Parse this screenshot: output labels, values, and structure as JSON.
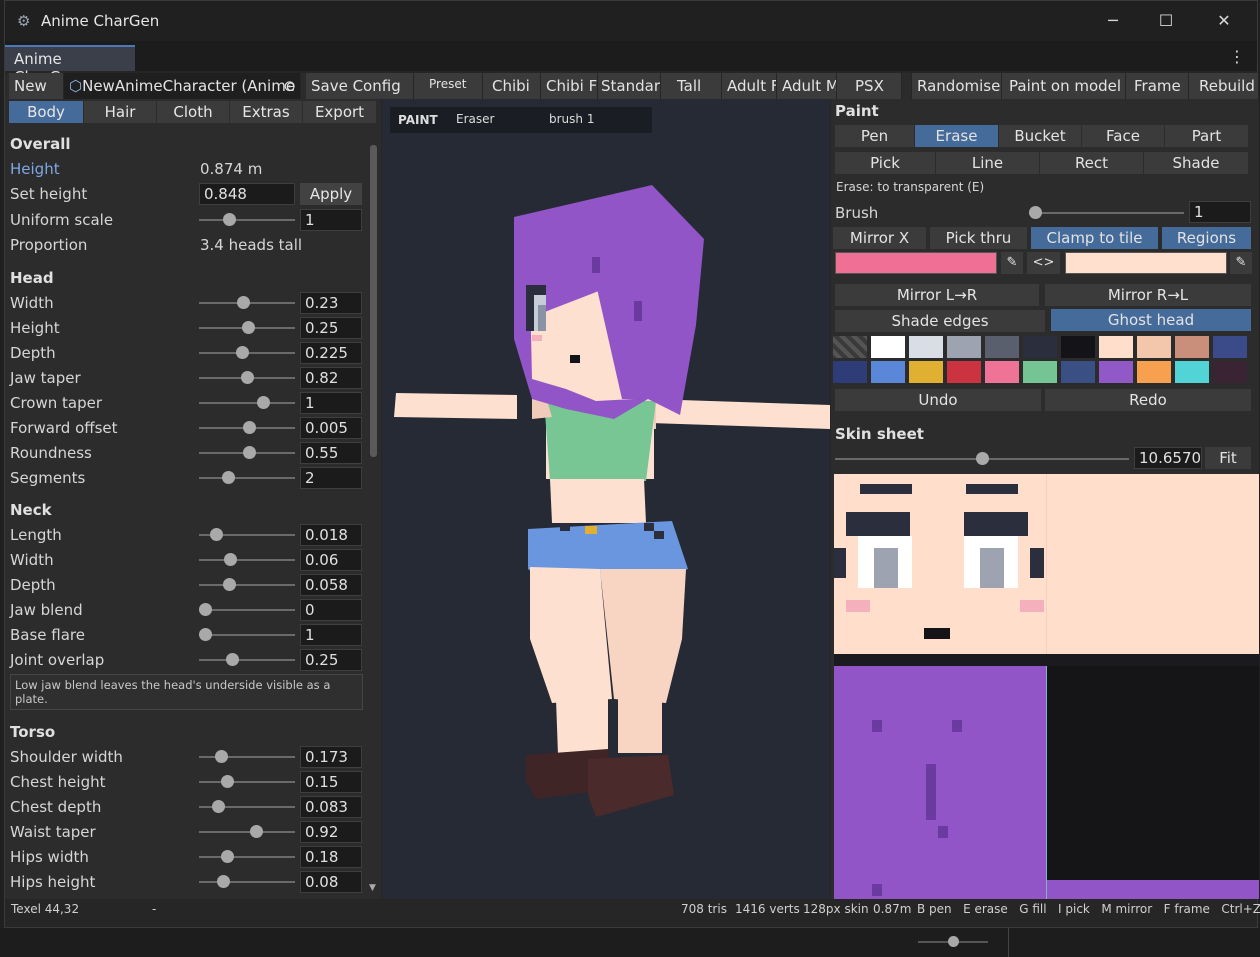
{
  "window": {
    "title": "Anime CharGen",
    "doc_tab": "Anime CharGen"
  },
  "toolbar": {
    "new": "New",
    "character_name": "NewAnimeCharacter (Anime",
    "save_config": "Save Config",
    "preset_label": "Preset",
    "presets": [
      "Chibi",
      "Chibi F",
      "Standard",
      "Tall",
      "Adult F",
      "Adult M",
      "PSX"
    ],
    "randomise": "Randomise",
    "paint_on_model": "Paint on model",
    "frame": "Frame",
    "rebuild": "Rebuild"
  },
  "left_tabs": [
    "Body",
    "Hair",
    "Cloth",
    "Extras",
    "Export"
  ],
  "overall": {
    "title": "Overall",
    "height_label": "Height",
    "height_value": "0.874 m",
    "set_height_label": "Set height",
    "set_height_value": "0.848",
    "apply": "Apply",
    "uniform_scale_label": "Uniform scale",
    "uniform_scale_value": "1",
    "proportion_label": "Proportion",
    "proportion_value": "3.4 heads tall"
  },
  "head": {
    "title": "Head",
    "rows": [
      {
        "label": "Width",
        "value": "0.23",
        "level": 0.46
      },
      {
        "label": "Height",
        "value": "0.25",
        "level": 0.52
      },
      {
        "label": "Depth",
        "value": "0.225",
        "level": 0.44
      },
      {
        "label": "Jaw taper",
        "value": "0.82",
        "level": 0.5
      },
      {
        "label": "Crown taper",
        "value": "1",
        "level": 0.7
      },
      {
        "label": "Forward offset",
        "value": "0.005",
        "level": 0.53
      },
      {
        "label": "Roundness",
        "value": "0.55",
        "level": 0.53
      },
      {
        "label": "Segments",
        "value": "2",
        "level": 0.28
      }
    ]
  },
  "neck": {
    "title": "Neck",
    "rows": [
      {
        "label": "Length",
        "value": "0.018",
        "level": 0.13
      },
      {
        "label": "Width",
        "value": "0.06",
        "level": 0.3
      },
      {
        "label": "Depth",
        "value": "0.058",
        "level": 0.29
      },
      {
        "label": "Jaw blend",
        "value": "0",
        "level": 0.0
      },
      {
        "label": "Base flare",
        "value": "1",
        "level": 0.0
      },
      {
        "label": "Joint overlap",
        "value": "0.25",
        "level": 0.33
      }
    ],
    "hint": "Low jaw blend leaves the head's underside visible as a plate."
  },
  "torso": {
    "title": "Torso",
    "rows": [
      {
        "label": "Shoulder width",
        "value": "0.173",
        "level": 0.19
      },
      {
        "label": "Chest height",
        "value": "0.15",
        "level": 0.26
      },
      {
        "label": "Chest depth",
        "value": "0.083",
        "level": 0.16
      },
      {
        "label": "Waist taper",
        "value": "0.92",
        "level": 0.62
      },
      {
        "label": "Hips width",
        "value": "0.18",
        "level": 0.26
      },
      {
        "label": "Hips height",
        "value": "0.08",
        "level": 0.22
      }
    ]
  },
  "viewport": {
    "mode": "PAINT",
    "tool": "Eraser",
    "brush": "brush 1"
  },
  "paint": {
    "title": "Paint",
    "tools_row1": [
      "Pen",
      "Erase",
      "Bucket",
      "Face",
      "Part"
    ],
    "tools_row2": [
      "Pick",
      "Line",
      "Rect",
      "Shade"
    ],
    "active_tool": "Erase",
    "hint": "Erase: to transparent (E)",
    "brush_label": "Brush",
    "brush_value": "1",
    "brush_level": 0.0,
    "options": [
      "Mirror X",
      "Pick thru",
      "Clamp to tile",
      "Regions"
    ],
    "primary_color": "#f06f95",
    "secondary_color": "#ffe0cf",
    "swap": "<>",
    "mirror_lr": "Mirror L→R",
    "mirror_rl": "Mirror R→L",
    "shade_edges": "Shade edges",
    "ghost_head": "Ghost head",
    "palette": [
      "#ffffff",
      "#d9dde6",
      "#9da3b1",
      "#5a5f6e",
      "#2b2f3d",
      "#131318",
      "#ffdfcc",
      "#f2c7ab",
      "#c98f7a",
      "#3b4a88",
      "#2e3d78",
      "#5a87d8",
      "#e0b032",
      "#cc3340",
      "#ee7397",
      "#74c494",
      "#3a4f83",
      "#9158c8",
      "#f7a050",
      "#52d3d6",
      "#3a2434"
    ],
    "undo": "Undo",
    "redo": "Redo"
  },
  "skin_sheet": {
    "title": "Skin sheet",
    "zoom": "10.6570",
    "zoom_level": 0.5,
    "fit": "Fit"
  },
  "status": {
    "texel": "Texel 44,32",
    "dash": "-",
    "tris": "708 tris",
    "verts": "1416 verts",
    "skin": "128px skin",
    "height": "0.87m",
    "keys": "B pen   E erase   G fill   I pick   M mirror   F frame   Ctrl+Z undo"
  },
  "taskbar": {
    "volume_level": 0.5
  }
}
